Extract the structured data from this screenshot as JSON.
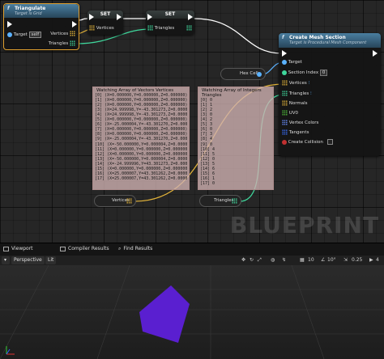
{
  "nodes": {
    "triangulate": {
      "title": "Triangulate",
      "subtitle": "Target is Grid",
      "target_label": "Target",
      "target_value": "self",
      "vertices_label": "Vertices",
      "triangles_label": "Triangles"
    },
    "set_vertices": {
      "title": "SET",
      "pin_label": "Vertices"
    },
    "set_triangles": {
      "title": "SET",
      "pin_label": "Triangles"
    },
    "create_mesh": {
      "title": "Create Mesh Section",
      "subtitle": "Target is Procedural Mesh Component",
      "pins": [
        "Target",
        "Section Index",
        "Vertices",
        "Triangles",
        "Normals",
        "UV0",
        "Vertex Colors",
        "Tangents",
        "Create Collision"
      ],
      "section_index_value": "0"
    },
    "hex_cell": {
      "label": "Hex Cell"
    },
    "get_vertices": {
      "label": "Vertices"
    },
    "get_triangles": {
      "label": "Triangles"
    }
  },
  "watch_vertices": {
    "title": "Watching Array of Vectors Vertices",
    "rows": [
      "[0] (X=0.000000,Y=0.000000,Z=0.000000)",
      "[1] (X=0.000000,Y=0.000000,Z=0.000000)",
      "[2] (X=0.000000,Y=0.000000,Z=0.000000)",
      "[3] (X=24.999998,Y=-43.301273,Z=0.000000)",
      "[4] (X=24.999998,Y=-43.301273,Z=0.000000)",
      "[5] (X=0.000000,Y=0.000000,Z=0.000000)",
      "[6] (X=-25.000004,Y=-43.301270,Z=0.000000)",
      "[7] (X=0.000000,Y=0.000000,Z=0.000000)",
      "[8] (X=0.000000,Y=0.000000,Z=0.000000)",
      "[9] (X=-25.000004,Y=-43.301270,Z=0.000000)",
      "[10] (X=-50.000000,Y=0.000004,Z=0.000000)",
      "[11] (X=0.000000,Y=0.000000,Z=0.000000)",
      "[12] (X=0.000000,Y=0.000000,Z=0.000000)",
      "[13] (X=-50.000000,Y=0.000004,Z=0.000000)",
      "[14] (X=-24.999996,Y=43.301273,Z=0.000000)",
      "[15] (X=0.000000,Y=0.000000,Z=0.000000)",
      "[16] (X=25.000007,Y=43.301262,Z=0.000000)",
      "[17] (X=25.000007,Y=43.301262,Z=0.000000)"
    ]
  },
  "watch_triangles": {
    "title": "Watching Array of Integers Triangles",
    "rows": [
      "[0] 0",
      "[1] 1",
      "[2] 2",
      "[3] 0",
      "[4] 2",
      "[5] 3",
      "[6] 0",
      "[7] 3",
      "[8] 4",
      "[9] 0",
      "[10] 4",
      "[11] 5",
      "[12] 0",
      "[13] 5",
      "[14] 6",
      "[15] 6",
      "[16] 1",
      "[17] 0"
    ]
  },
  "watermark": "BLUEPRINT",
  "tabs": {
    "viewport": "Viewport",
    "compiler_results": "Compiler Results",
    "find_results": "Find Results"
  },
  "viewport_toolbar": {
    "perspective": "Perspective",
    "lit": "Lit",
    "grid_snap": "10",
    "rot_snap": "10°",
    "scale_snap": "0.25",
    "camera_speed": "4"
  },
  "colors": {
    "vector_pin": "#e3b43a",
    "int_pin": "#3fd79c",
    "object_pin": "#5bb2ff",
    "mesh": "#5a1fd0",
    "watch_bg": "#d2b4b4"
  }
}
